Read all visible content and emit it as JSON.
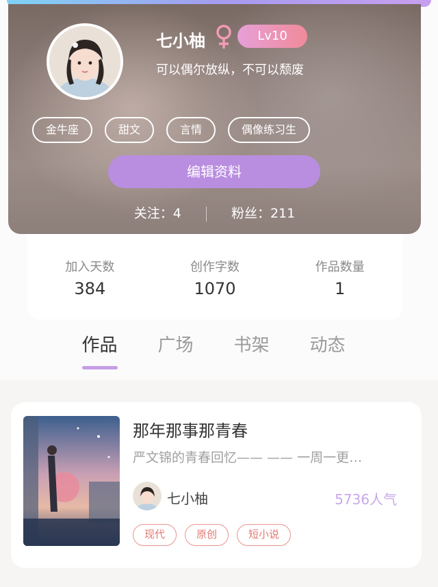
{
  "profile": {
    "name": "七小柚",
    "level": "Lv10",
    "signature": "可以偶尔放纵，不可以颓废",
    "tags": [
      "金牛座",
      "甜文",
      "言情",
      "偶像练习生"
    ],
    "edit_label": "编辑资料",
    "following_label": "关注：",
    "following_count": "4",
    "followers_label": "粉丝：",
    "followers_count": "211"
  },
  "stats": [
    {
      "label": "加入天数",
      "value": "384"
    },
    {
      "label": "创作字数",
      "value": "1070"
    },
    {
      "label": "作品数量",
      "value": "1"
    }
  ],
  "tabs": [
    {
      "label": "作品",
      "active": true
    },
    {
      "label": "广场",
      "active": false
    },
    {
      "label": "书架",
      "active": false
    },
    {
      "label": "动态",
      "active": false
    }
  ],
  "work": {
    "title": "那年那事那青春",
    "description": "严文锦的青春回忆—— —— 一周一更…",
    "author": "七小柚",
    "popularity": "5736人气",
    "tags": [
      "现代",
      "原创",
      "短小说"
    ]
  },
  "colors": {
    "accent_purple": "#b98ee0",
    "tab_indicator": "#c59ee6",
    "popularity": "#c9a7ec",
    "tag_red": "#e07a74",
    "female_symbol": "#f29bb5"
  },
  "icons": {
    "gender": "female-symbol-icon"
  }
}
